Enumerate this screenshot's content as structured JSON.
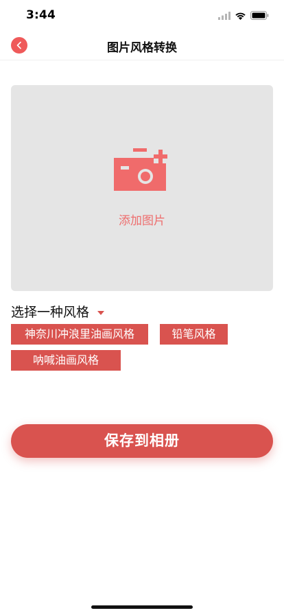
{
  "status_bar": {
    "time": "3:44",
    "icons": [
      "signal-icon",
      "wifi-icon",
      "battery-icon"
    ]
  },
  "nav": {
    "title": "图片风格转换",
    "back_icon": "chevron-left-icon"
  },
  "upload": {
    "icon": "camera-add-icon",
    "label": "添加图片"
  },
  "style_selector": {
    "label": "选择一种风格",
    "caret_icon": "caret-down-icon",
    "options": [
      "神奈川冲浪里油画风格",
      "铅笔风格",
      "呐喊油画风格"
    ]
  },
  "actions": {
    "save_label": "保存到相册"
  },
  "colors": {
    "accent": "#d9534f",
    "accent_light": "#ee6e6e",
    "placeholder_bg": "#e5e5e5"
  }
}
